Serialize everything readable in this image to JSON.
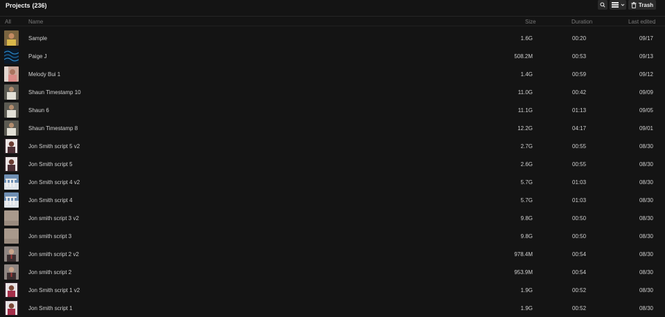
{
  "header": {
    "title": "Projects",
    "count": "(236)",
    "trash_label": "Trash",
    "icons": {
      "search": "search-icon",
      "view": "list-view-icon",
      "dropdown": "chevron-down-icon",
      "trash": "trash-icon"
    }
  },
  "columns": {
    "all": "All",
    "name": "Name",
    "size": "Size",
    "duration": "Duration",
    "last_edited": "Last edited",
    "sort_icon": "↓"
  },
  "projects": [
    {
      "name": "Sample",
      "size": "1.6G",
      "duration": "00:20",
      "edited": "09/17",
      "thumb": "portrait-yellow"
    },
    {
      "name": "Paige J",
      "size": "508.2M",
      "duration": "00:53",
      "edited": "09/13",
      "thumb": "blue-waves"
    },
    {
      "name": "Melody Bui 1",
      "size": "1.4G",
      "duration": "00:59",
      "edited": "09/12",
      "thumb": "portrait-pink"
    },
    {
      "name": "Shaun Timestamp 10",
      "size": "11.0G",
      "duration": "00:42",
      "edited": "09/09",
      "thumb": "portrait-grey"
    },
    {
      "name": "Shaun 6",
      "size": "11.1G",
      "duration": "01:13",
      "edited": "09/05",
      "thumb": "portrait-grey"
    },
    {
      "name": "Shaun Timestamp 8",
      "size": "12.2G",
      "duration": "04:17",
      "edited": "09/01",
      "thumb": "portrait-grey"
    },
    {
      "name": "Jon Smith script 5 v2",
      "size": "2.7G",
      "duration": "00:55",
      "edited": "08/30",
      "thumb": "portrait-dark"
    },
    {
      "name": "Jon Smith script 5",
      "size": "2.6G",
      "duration": "00:55",
      "edited": "08/30",
      "thumb": "portrait-dark"
    },
    {
      "name": "Jon Smith script 4 v2",
      "size": "5.7G",
      "duration": "01:03",
      "edited": "08/30",
      "thumb": "building-blue"
    },
    {
      "name": "Jon Smith script 4",
      "size": "5.7G",
      "duration": "01:03",
      "edited": "08/30",
      "thumb": "building-blue"
    },
    {
      "name": "Jon smith script 3 v2",
      "size": "9.8G",
      "duration": "00:50",
      "edited": "08/30",
      "thumb": "beige-plain"
    },
    {
      "name": "Jon smith script 3",
      "size": "9.8G",
      "duration": "00:50",
      "edited": "08/30",
      "thumb": "beige-plain"
    },
    {
      "name": "Jon smith script 2 v2",
      "size": "978.4M",
      "duration": "00:54",
      "edited": "08/30",
      "thumb": "portrait-suit"
    },
    {
      "name": "Jon smith script 2",
      "size": "953.9M",
      "duration": "00:54",
      "edited": "08/30",
      "thumb": "portrait-suit"
    },
    {
      "name": "Jon Smith script 1 v2",
      "size": "1.9G",
      "duration": "00:52",
      "edited": "08/30",
      "thumb": "portrait-red"
    },
    {
      "name": "Jon Smith script 1",
      "size": "1.9G",
      "duration": "00:52",
      "edited": "08/30",
      "thumb": "portrait-red"
    }
  ]
}
